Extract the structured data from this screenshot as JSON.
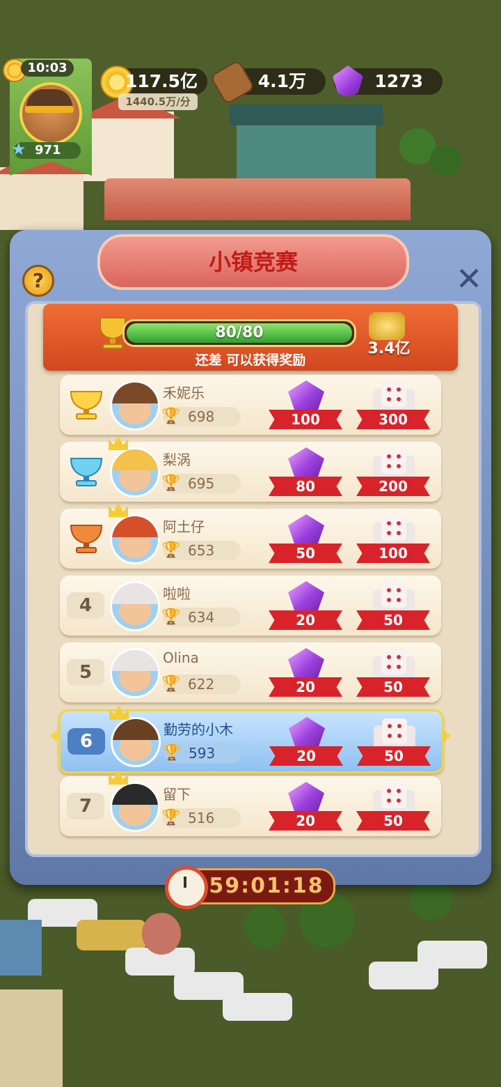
{
  "hud": {
    "time": "10:03",
    "level": "971",
    "coins": "117.5亿",
    "coin_rate": "1440.5万/分",
    "wood": "4.1万",
    "gems": "1273"
  },
  "panel": {
    "title": "小镇竞赛",
    "help_label": "?",
    "progress_text": "80/80",
    "progress_fraction": 1.0,
    "reward_amount": "3.4亿",
    "subtitle": "还差 可以获得奖励"
  },
  "leaderboard": [
    {
      "rank": "1",
      "name": "禾妮乐",
      "score": "698",
      "gems": "100",
      "dice": "300",
      "badge": "gold",
      "crown": false,
      "me": false
    },
    {
      "rank": "2",
      "name": "梨涡",
      "score": "695",
      "gems": "80",
      "dice": "200",
      "badge": "blue",
      "crown": true,
      "me": false
    },
    {
      "rank": "3",
      "name": "阿土仔",
      "score": "653",
      "gems": "50",
      "dice": "100",
      "badge": "bronze",
      "crown": true,
      "me": false
    },
    {
      "rank": "4",
      "name": "啦啦",
      "score": "634",
      "gems": "20",
      "dice": "50",
      "badge": "plain",
      "crown": false,
      "me": false
    },
    {
      "rank": "5",
      "name": "Olina",
      "score": "622",
      "gems": "20",
      "dice": "50",
      "badge": "plain",
      "crown": false,
      "me": false
    },
    {
      "rank": "6",
      "name": "勤劳的小木",
      "score": "593",
      "gems": "20",
      "dice": "50",
      "badge": "me",
      "crown": true,
      "me": true
    },
    {
      "rank": "7",
      "name": "留下",
      "score": "516",
      "gems": "20",
      "dice": "50",
      "badge": "plain",
      "crown": true,
      "me": false
    }
  ],
  "timer": "59:01:18",
  "colors": {
    "accent_orange": "#d2471e",
    "title_red": "#c21c16",
    "progress_green": "#2fa030",
    "ribbon_red": "#d8232a",
    "highlight_blue": "#8fc1f0"
  }
}
